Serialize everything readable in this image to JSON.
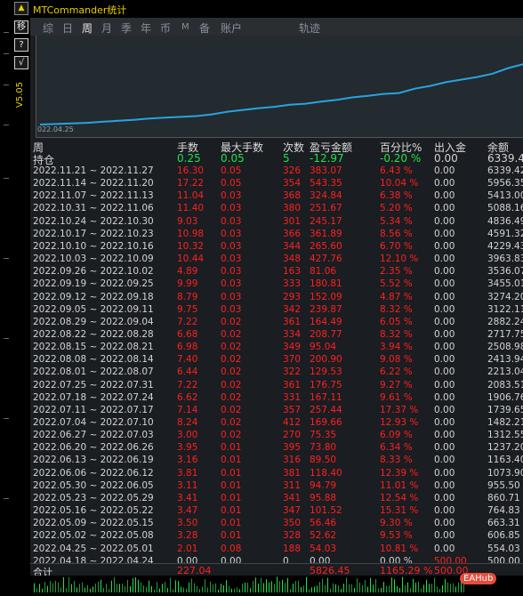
{
  "window": {
    "title": "MTCommander统计"
  },
  "left_toolbar": {
    "move_label": "移",
    "help_label": "?",
    "check_label": "√",
    "vertical_text": "V5.05"
  },
  "tabs": [
    {
      "label": "综",
      "active": false
    },
    {
      "label": "日",
      "active": false
    },
    {
      "label": "周",
      "active": true
    },
    {
      "label": "月",
      "active": false
    },
    {
      "label": "季",
      "active": false
    },
    {
      "label": "年",
      "active": false
    },
    {
      "label": "币",
      "active": false
    },
    {
      "label": "M",
      "active": false
    },
    {
      "label": "备",
      "active": false
    },
    {
      "label": "账户",
      "active": false
    },
    {
      "label": "轨迹",
      "active": false
    }
  ],
  "chart": {
    "start_date": "022.04.25",
    "line_color": "#29a3e0"
  },
  "chart_data": {
    "type": "line",
    "x": [
      "2022.04.18",
      "2022.04.25",
      "2022.05.02",
      "2022.05.09",
      "2022.05.16",
      "2022.05.23",
      "2022.05.30",
      "2022.06.06",
      "2022.06.13",
      "2022.06.20",
      "2022.06.27",
      "2022.07.04",
      "2022.07.11",
      "2022.07.18",
      "2022.07.25",
      "2022.08.01",
      "2022.08.08",
      "2022.08.15",
      "2022.08.22",
      "2022.08.29",
      "2022.09.05",
      "2022.09.12",
      "2022.09.19",
      "2022.09.26",
      "2022.10.03",
      "2022.10.10",
      "2022.10.17",
      "2022.10.24",
      "2022.10.31",
      "2022.11.07",
      "2022.11.14",
      "2022.11.21"
    ],
    "values": [
      500.0,
      554.03,
      606.85,
      663.31,
      764.83,
      860.71,
      955.5,
      1073.9,
      1163.4,
      1237.2,
      1312.55,
      1482.21,
      1739.65,
      1906.76,
      2083.51,
      2213.04,
      2413.94,
      2508.98,
      2717.75,
      2882.24,
      3122.11,
      3274.2,
      3455.01,
      3536.07,
      3963.83,
      4229.43,
      4591.32,
      4836.49,
      5088.16,
      5413.0,
      5956.35,
      6339.42
    ]
  },
  "table": {
    "headers": [
      "周",
      "手数",
      "最大手数",
      "次数",
      "盈亏金额",
      "百分比%",
      "出入金",
      "余额"
    ],
    "holding": {
      "label": "持仓",
      "lots": "0.25",
      "max_lots": "0.05",
      "count": "5",
      "pnl": "-12.97",
      "pct": "-0.20 %",
      "flow": "0.00",
      "balance": "6339.42"
    },
    "rows": [
      {
        "week": "2022.11.21 ~ 2022.11.27",
        "lots": "16.30",
        "max": "0.05",
        "count": "326",
        "pnl": "383.07",
        "pct": "6.43 %",
        "flow": "0.00",
        "balance": "6339.42"
      },
      {
        "week": "2022.11.14 ~ 2022.11.20",
        "lots": "17.22",
        "max": "0.05",
        "count": "354",
        "pnl": "543.35",
        "pct": "10.04 %",
        "flow": "0.00",
        "balance": "5956.35"
      },
      {
        "week": "2022.11.07 ~ 2022.11.13",
        "lots": "11.04",
        "max": "0.03",
        "count": "368",
        "pnl": "324.84",
        "pct": "6.38 %",
        "flow": "0.00",
        "balance": "5413.00"
      },
      {
        "week": "2022.10.31 ~ 2022.11.06",
        "lots": "11.40",
        "max": "0.03",
        "count": "380",
        "pnl": "251.67",
        "pct": "5.20 %",
        "flow": "0.00",
        "balance": "5088.16"
      },
      {
        "week": "2022.10.24 ~ 2022.10.30",
        "lots": "9.03",
        "max": "0.03",
        "count": "301",
        "pnl": "245.17",
        "pct": "5.34 %",
        "flow": "0.00",
        "balance": "4836.49"
      },
      {
        "week": "2022.10.17 ~ 2022.10.23",
        "lots": "10.98",
        "max": "0.03",
        "count": "366",
        "pnl": "361.89",
        "pct": "8.56 %",
        "flow": "0.00",
        "balance": "4591.32"
      },
      {
        "week": "2022.10.10 ~ 2022.10.16",
        "lots": "10.32",
        "max": "0.03",
        "count": "344",
        "pnl": "265.60",
        "pct": "6.70 %",
        "flow": "0.00",
        "balance": "4229.43"
      },
      {
        "week": "2022.10.03 ~ 2022.10.09",
        "lots": "10.44",
        "max": "0.03",
        "count": "348",
        "pnl": "427.76",
        "pct": "12.10 %",
        "flow": "0.00",
        "balance": "3963.83"
      },
      {
        "week": "2022.09.26 ~ 2022.10.02",
        "lots": "4.89",
        "max": "0.03",
        "count": "163",
        "pnl": "81.06",
        "pct": "2.35 %",
        "flow": "0.00",
        "balance": "3536.07"
      },
      {
        "week": "2022.09.19 ~ 2022.09.25",
        "lots": "9.99",
        "max": "0.03",
        "count": "333",
        "pnl": "180.81",
        "pct": "5.52 %",
        "flow": "0.00",
        "balance": "3455.01"
      },
      {
        "week": "2022.09.12 ~ 2022.09.18",
        "lots": "8.79",
        "max": "0.03",
        "count": "293",
        "pnl": "152.09",
        "pct": "4.87 %",
        "flow": "0.00",
        "balance": "3274.20"
      },
      {
        "week": "2022.09.05 ~ 2022.09.11",
        "lots": "9.75",
        "max": "0.03",
        "count": "342",
        "pnl": "239.87",
        "pct": "8.32 %",
        "flow": "0.00",
        "balance": "3122.11"
      },
      {
        "week": "2022.08.29 ~ 2022.09.04",
        "lots": "7.22",
        "max": "0.02",
        "count": "361",
        "pnl": "164.49",
        "pct": "6.05 %",
        "flow": "0.00",
        "balance": "2882.24"
      },
      {
        "week": "2022.08.22 ~ 2022.08.28",
        "lots": "6.68",
        "max": "0.02",
        "count": "334",
        "pnl": "208.77",
        "pct": "8.32 %",
        "flow": "0.00",
        "balance": "2717.75"
      },
      {
        "week": "2022.08.15 ~ 2022.08.21",
        "lots": "6.98",
        "max": "0.02",
        "count": "349",
        "pnl": "95.04",
        "pct": "3.94 %",
        "flow": "0.00",
        "balance": "2508.98"
      },
      {
        "week": "2022.08.08 ~ 2022.08.14",
        "lots": "7.40",
        "max": "0.02",
        "count": "370",
        "pnl": "200.90",
        "pct": "9.08 %",
        "flow": "0.00",
        "balance": "2413.94"
      },
      {
        "week": "2022.08.01 ~ 2022.08.07",
        "lots": "6.44",
        "max": "0.02",
        "count": "322",
        "pnl": "129.53",
        "pct": "6.22 %",
        "flow": "0.00",
        "balance": "2213.04"
      },
      {
        "week": "2022.07.25 ~ 2022.07.31",
        "lots": "7.22",
        "max": "0.02",
        "count": "361",
        "pnl": "176.75",
        "pct": "9.27 %",
        "flow": "0.00",
        "balance": "2083.51"
      },
      {
        "week": "2022.07.18 ~ 2022.07.24",
        "lots": "6.62",
        "max": "0.02",
        "count": "331",
        "pnl": "167.11",
        "pct": "9.61 %",
        "flow": "0.00",
        "balance": "1906.76"
      },
      {
        "week": "2022.07.11 ~ 2022.07.17",
        "lots": "7.14",
        "max": "0.02",
        "count": "357",
        "pnl": "257.44",
        "pct": "17.37 %",
        "flow": "0.00",
        "balance": "1739.65"
      },
      {
        "week": "2022.07.04 ~ 2022.07.10",
        "lots": "8.24",
        "max": "0.02",
        "count": "412",
        "pnl": "169.66",
        "pct": "12.93 %",
        "flow": "0.00",
        "balance": "1482.21"
      },
      {
        "week": "2022.06.27 ~ 2022.07.03",
        "lots": "3.00",
        "max": "0.02",
        "count": "270",
        "pnl": "75.35",
        "pct": "6.09 %",
        "flow": "0.00",
        "balance": "1312.55"
      },
      {
        "week": "2022.06.20 ~ 2022.06.26",
        "lots": "3.95",
        "max": "0.01",
        "count": "395",
        "pnl": "73.80",
        "pct": "6.34 %",
        "flow": "0.00",
        "balance": "1237.20"
      },
      {
        "week": "2022.06.13 ~ 2022.06.19",
        "lots": "3.16",
        "max": "0.01",
        "count": "316",
        "pnl": "89.50",
        "pct": "8.33 %",
        "flow": "0.00",
        "balance": "1163.40"
      },
      {
        "week": "2022.06.06 ~ 2022.06.12",
        "lots": "3.81",
        "max": "0.01",
        "count": "381",
        "pnl": "118.40",
        "pct": "12.39 %",
        "flow": "0.00",
        "balance": "1073.90"
      },
      {
        "week": "2022.05.30 ~ 2022.06.05",
        "lots": "3.11",
        "max": "0.01",
        "count": "311",
        "pnl": "94.79",
        "pct": "11.01 %",
        "flow": "0.00",
        "balance": "955.50"
      },
      {
        "week": "2022.05.23 ~ 2022.05.29",
        "lots": "3.41",
        "max": "0.01",
        "count": "341",
        "pnl": "95.88",
        "pct": "12.54 %",
        "flow": "0.00",
        "balance": "860.71"
      },
      {
        "week": "2022.05.16 ~ 2022.05.22",
        "lots": "3.47",
        "max": "0.01",
        "count": "347",
        "pnl": "101.52",
        "pct": "15.31 %",
        "flow": "0.00",
        "balance": "764.83"
      },
      {
        "week": "2022.05.09 ~ 2022.05.15",
        "lots": "3.50",
        "max": "0.01",
        "count": "350",
        "pnl": "56.46",
        "pct": "9.30 %",
        "flow": "0.00",
        "balance": "663.31"
      },
      {
        "week": "2022.05.02 ~ 2022.05.08",
        "lots": "3.28",
        "max": "0.01",
        "count": "328",
        "pnl": "52.62",
        "pct": "9.53 %",
        "flow": "0.00",
        "balance": "606.85"
      },
      {
        "week": "2022.04.25 ~ 2022.05.01",
        "lots": "2.01",
        "max": "0.08",
        "count": "188",
        "pnl": "54.03",
        "pct": "10.81 %",
        "flow": "0.00",
        "balance": "554.03"
      },
      {
        "week": "2022.04.18 ~ 2022.04.24",
        "lots": "0.00",
        "max": "0.00",
        "count": "0",
        "pnl": "0.00",
        "pct": "0.00 %",
        "flow": "500.00",
        "balance": "500.00"
      }
    ],
    "total": {
      "label": "合计",
      "lots": "227.04",
      "pnl": "5826.45",
      "pct": "1165.29 %",
      "flow": "500.00"
    }
  },
  "watermark": {
    "text": "EAHub"
  },
  "colors": {
    "positive": "#ff2020",
    "green": "#22e14b",
    "neutral": "#d4d4d4",
    "title": "#e7d000"
  }
}
